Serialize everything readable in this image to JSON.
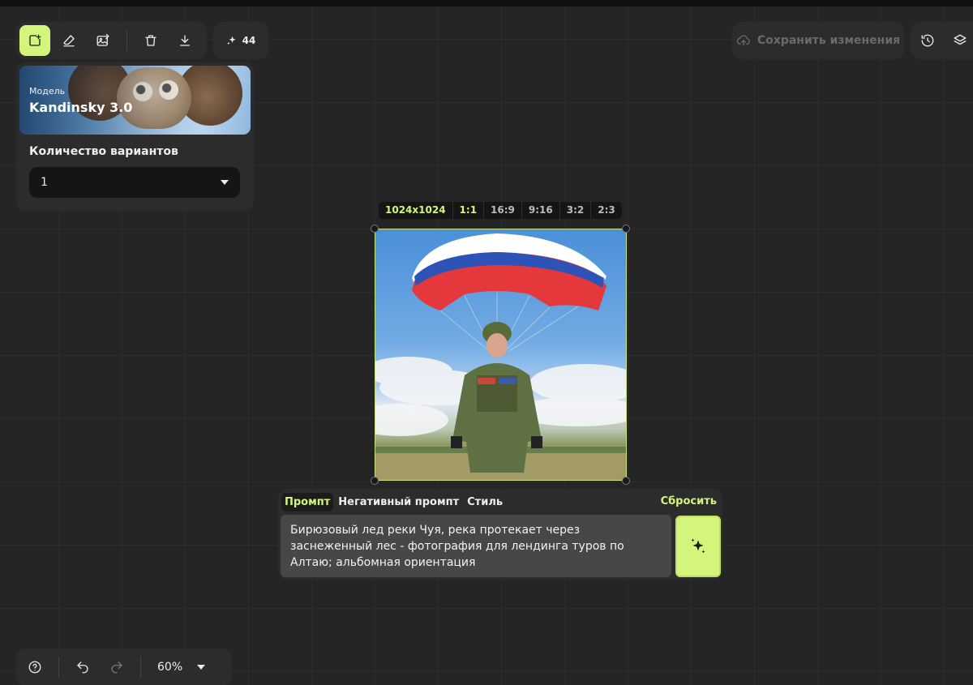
{
  "toolbar": {
    "credits": "44"
  },
  "header": {
    "save_label": "Сохранить изменения"
  },
  "model_card": {
    "label": "Модель",
    "name": "Kandinsky 3.0",
    "variants_label": "Количество вариантов",
    "variants_value": "1"
  },
  "ratios": [
    "1024x1024",
    "1:1",
    "16:9",
    "9:16",
    "3:2",
    "2:3"
  ],
  "selected_ratios": [
    "1024x1024",
    "1:1"
  ],
  "prompt_panel": {
    "tabs": [
      "Промпт",
      "Негативный промпт",
      "Стиль"
    ],
    "active_tab": "Промпт",
    "reset_label": "Сбросить",
    "prompt_text": "Бирюзовый лед реки Чуя, река протекает через заснеженный лес - фотография для лендинга туров по Алтаю; альбомная ориентация"
  },
  "bottombar": {
    "zoom": "60%"
  },
  "colors": {
    "accent": "#d4f57c",
    "background": "#252525",
    "panel": "#2c2c2c"
  },
  "icons": {
    "toolbar": [
      "add-image-icon",
      "eraser-icon",
      "edit-image-icon",
      "trash-icon",
      "download-icon"
    ],
    "credits": "sparkle-icon",
    "save": "cloud-upload-icon",
    "right": [
      "history-icon",
      "layers-icon"
    ],
    "bottom": [
      "help-icon",
      "undo-icon",
      "redo-icon",
      "chevron-down-icon"
    ],
    "generate": "sparkle-icon"
  }
}
